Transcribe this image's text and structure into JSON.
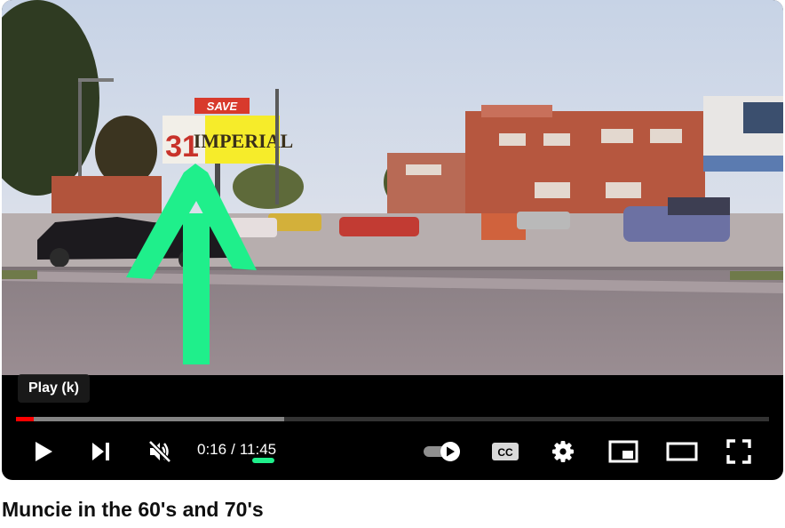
{
  "video": {
    "title": "Muncie in the 60's and 70's",
    "sign_save": "SAVE",
    "sign_imperial": "IMPERIAL",
    "sign_price": "31",
    "annotation_color": "#1fef8b"
  },
  "player": {
    "tooltip": "Play (k)",
    "current_time": "0:16",
    "time_separator": "/",
    "duration": "11:45",
    "progress": {
      "played_fraction": 0.024,
      "loaded_fraction": 0.356
    },
    "accent_color": "#ff0000",
    "controls": [
      {
        "name": "play-button",
        "icon": "play-icon"
      },
      {
        "name": "next-button",
        "icon": "skip-next-icon"
      },
      {
        "name": "mute-button",
        "icon": "volume-muted-icon"
      },
      {
        "name": "autoplay-toggle",
        "icon": "autoplay-toggle-icon"
      },
      {
        "name": "captions-button",
        "icon": "cc-icon",
        "label": "CC"
      },
      {
        "name": "settings-button",
        "icon": "gear-icon"
      },
      {
        "name": "miniplayer-button",
        "icon": "miniplayer-icon"
      },
      {
        "name": "theater-button",
        "icon": "theater-mode-icon"
      },
      {
        "name": "fullscreen-button",
        "icon": "fullscreen-icon"
      }
    ]
  }
}
